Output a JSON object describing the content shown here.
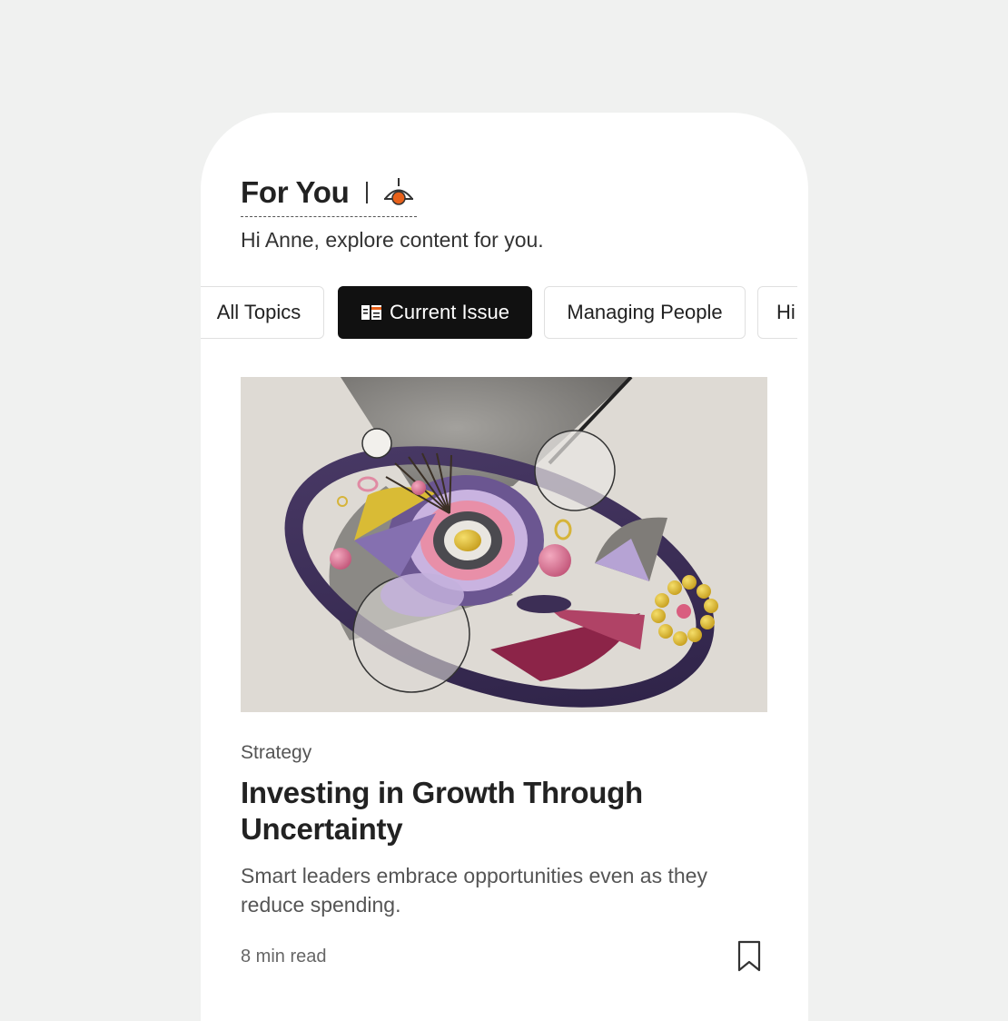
{
  "header": {
    "title": "For You",
    "icon": "recommendation-icon",
    "accent_color": "#e8611a"
  },
  "greeting": "Hi Anne, explore content for you.",
  "topics": [
    {
      "label": "All Topics",
      "active": false
    },
    {
      "label": "Current Issue",
      "active": true,
      "icon": "magazine-icon"
    },
    {
      "label": "Managing People",
      "active": false
    },
    {
      "label": "Hi",
      "active": false
    }
  ],
  "article": {
    "image": "abstract-3d-illustration",
    "category": "Strategy",
    "headline": "Investing in Growth Through Uncertainty",
    "dek": "Smart leaders embrace opportunities even as they reduce spending.",
    "read_time": "8 min read",
    "bookmark_icon": "bookmark-icon"
  }
}
